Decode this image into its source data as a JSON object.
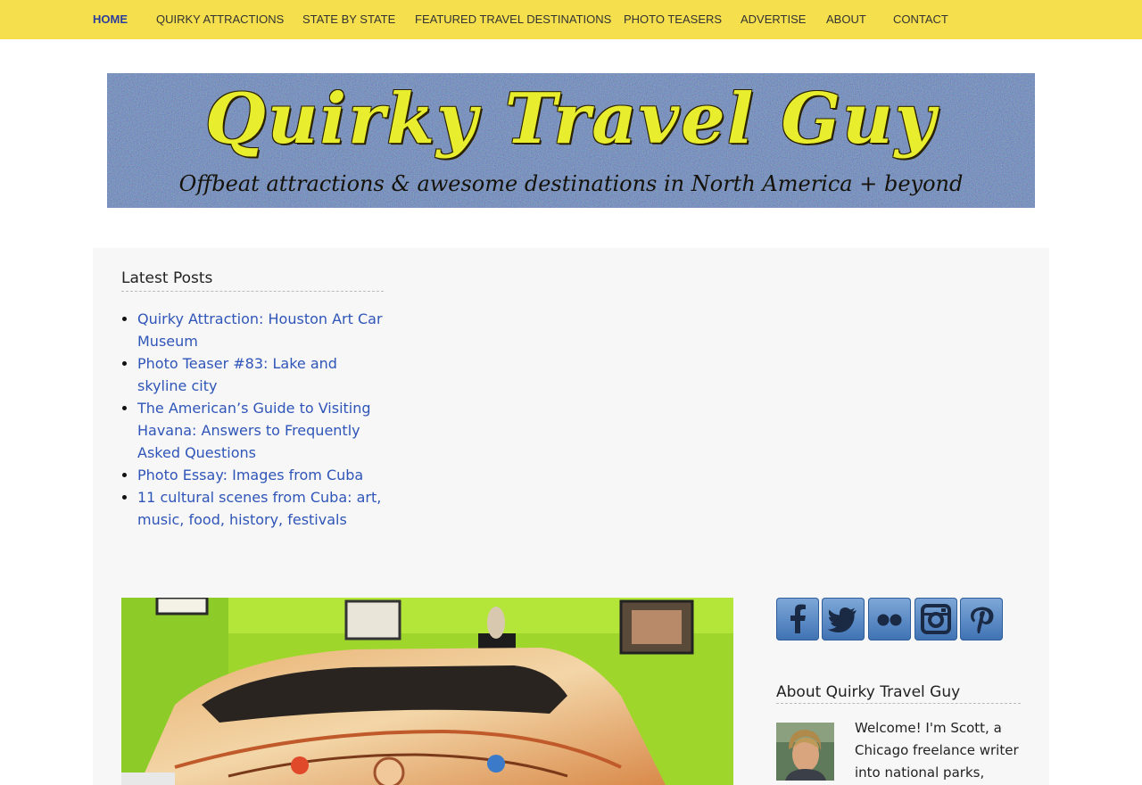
{
  "nav": {
    "items": [
      {
        "label": "HOME",
        "active": true
      },
      {
        "label": "QUIRKY ATTRACTIONS"
      },
      {
        "label": "STATE BY STATE"
      },
      {
        "label": "FEATURED TRAVEL DESTINATIONS"
      },
      {
        "label": "PHOTO TEASERS"
      },
      {
        "label": "ADVERTISE"
      },
      {
        "label": "ABOUT"
      },
      {
        "label": "CONTACT"
      }
    ]
  },
  "banner": {
    "title": "Quirky Travel Guy",
    "tagline": "Offbeat attractions & awesome destinations in North America + beyond"
  },
  "latest_posts": {
    "title": "Latest Posts",
    "items": [
      "Quirky Attraction: Houston Art Car Museum",
      "Photo Teaser #83: Lake and skyline city",
      "The American’s Guide to Visiting Havana: Answers to Frequently Asked Questions",
      "Photo Essay: Images from Cuba",
      "11 cultural scenes from Cuba: art, music, food, history, festivals"
    ]
  },
  "social": {
    "icons": [
      "facebook-icon",
      "twitter-icon",
      "flickr-icon",
      "instagram-icon",
      "pinterest-icon"
    ]
  },
  "about": {
    "title": "About Quirky Travel Guy",
    "text": "Welcome! I'm Scott, a Chicago freelance writer into national parks,"
  },
  "colors": {
    "nav_bg": "#f5df4d",
    "nav_active": "#2d3f9a",
    "link": "#2f55b8",
    "banner_title": "#e8ee2e",
    "content_bg": "#f7f7f7"
  }
}
